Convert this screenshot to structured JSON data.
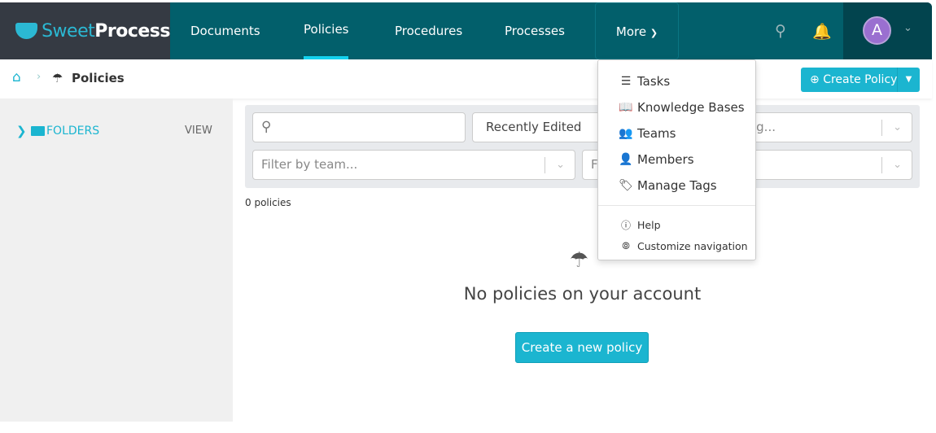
{
  "brand": {
    "name_light": "Sweet",
    "name_bold": "Process"
  },
  "nav": {
    "items": [
      "Documents",
      "Policies",
      "Procedures",
      "Processes"
    ],
    "more": "More",
    "active": "Policies"
  },
  "user": {
    "initial": "A"
  },
  "breadcrumb": {
    "current": "Policies"
  },
  "create_button": "Create Policy",
  "sidebar": {
    "folders": "FOLDERS",
    "view": "VIEW"
  },
  "filters": {
    "search_placeholder": "",
    "sort": "Recently Edited",
    "tag_placeholder": "Filter by tag...",
    "team_placeholder": "Filter by team...",
    "other_placeholder": "F"
  },
  "count": "0 policies",
  "empty": {
    "title": "No policies on your account",
    "button": "Create a new policy"
  },
  "more_menu": {
    "items": [
      "Tasks",
      "Knowledge Bases",
      "Teams",
      "Members",
      "Manage Tags"
    ],
    "secondary": [
      "Help",
      "Customize navigation"
    ]
  },
  "colors": {
    "nav": "#025f6b",
    "logo_bg": "#353a43",
    "accent": "#1bb5d0",
    "avatar": "#9a6fd0"
  }
}
